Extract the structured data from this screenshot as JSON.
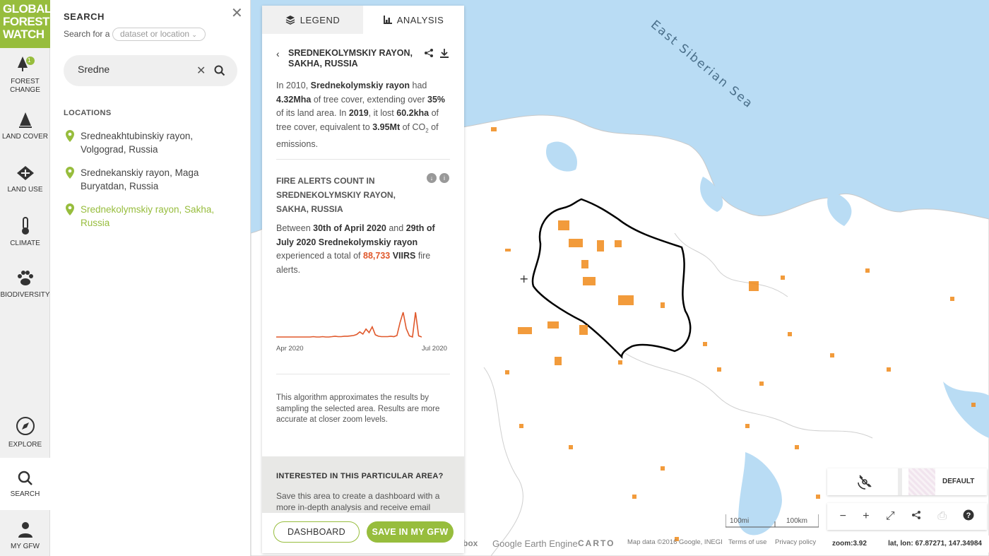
{
  "brand": {
    "logo_line1": "GLOBAL",
    "logo_line2": "FOREST",
    "logo_line3": "WATCH"
  },
  "nav": {
    "forest_change": "FOREST CHANGE",
    "forest_change_badge": "1",
    "land_cover": "LAND COVER",
    "land_use": "LAND USE",
    "climate": "CLIMATE",
    "biodiversity": "BIODIVERSITY",
    "explore": "EXPLORE",
    "search": "SEARCH",
    "my_gfw": "MY GFW"
  },
  "search": {
    "title": "SEARCH",
    "search_for": "Search for a",
    "dropdown": "dataset or location",
    "query": "Sredne",
    "locations_heading": "LOCATIONS",
    "results": [
      {
        "line1": "Sredneakhtubinskiy rayon,",
        "line2": "Volgograd, Russia"
      },
      {
        "line1": "Srednekanskiy rayon, Maga",
        "line2": "Buryatdan, Russia"
      },
      {
        "line1": "Srednekolymskiy rayon, Sakha,",
        "line2": "Russia"
      }
    ]
  },
  "tabs": {
    "legend": "LEGEND",
    "analysis": "ANALYSIS"
  },
  "analysis": {
    "area_line1": "SREDNEKOLYMSKIY RAYON,",
    "area_line2": "SAKHA, RUSSIA",
    "summary": {
      "p1": "In 2010, ",
      "b1": "Srednekolymskiy rayon",
      "p2": " had ",
      "b2": "4.32Mha",
      "p3": " of tree cover, extending over ",
      "b3": "35%",
      "p4": " of its land area. In ",
      "b4": "2019",
      "p5": ", it lost ",
      "b5": "60.2kha",
      "p6": " of tree cover, equivalent to ",
      "b6": "3.95Mt",
      "p7": " of CO",
      "sub": "2",
      "p8": " of emissions."
    },
    "fire_title_line1": "FIRE ALERTS COUNT IN",
    "fire_title_line2": "SREDNEKOLYMSKIY RAYON,",
    "fire_title_line3": "SAKHA, RUSSIA",
    "fire": {
      "p1": "Between ",
      "b1": "30th of April 2020",
      "p2": " and ",
      "b2": "29th of July 2020 Srednekolymskiy rayon",
      "p3": " experienced a total of ",
      "count": "88,733",
      "p4": " ",
      "b3": "VIIRS",
      "p5": " fire alerts."
    },
    "chart_x_start": "Apr 2020",
    "chart_x_end": "Jul 2020",
    "note": "This algorithm approximates the results by sampling the selected area. Results are more accurate at closer zoom levels.",
    "interest_heading": "INTERESTED IN THIS PARTICULAR AREA?",
    "interest_text": "Save this area to create a dashboard with a more in-depth analysis and receive email",
    "btn_dashboard": "DASHBOARD",
    "btn_save": "SAVE IN MY GFW"
  },
  "chart_data": {
    "type": "line",
    "x": [
      "Apr 2020",
      "Jul 2020"
    ],
    "series": [
      {
        "values": [
          2,
          2,
          2,
          2,
          2,
          2,
          2,
          2,
          2,
          2,
          2,
          2,
          3,
          2,
          2,
          3,
          2,
          2,
          3,
          4,
          3,
          3,
          4,
          4,
          5,
          6,
          9,
          16,
          10,
          24,
          14,
          30,
          8,
          4,
          3,
          3,
          3,
          4,
          3,
          6,
          42,
          70,
          25,
          5,
          2,
          70,
          5,
          2
        ]
      }
    ],
    "color": "#e0582b"
  },
  "map": {
    "sea_label": "East Siberian Sea",
    "basemap_label": "DEFAULT",
    "scale_mi": "100mi",
    "scale_km": "100km",
    "attrib_box": "box",
    "attrib_gee": "Google Earth Engine",
    "attrib_carto": "CARTO",
    "attrib_data": "Map data ©2016 Google, INEGI",
    "attrib_terms": "Terms of use",
    "attrib_privacy": "Privacy policy",
    "zoom": "zoom:3.92",
    "coords": "lat, lon: 67.87271, 147.34984"
  },
  "colors": {
    "brand": "#97bd3d",
    "fire": "#e0582b",
    "water": "#b9dcf4"
  }
}
